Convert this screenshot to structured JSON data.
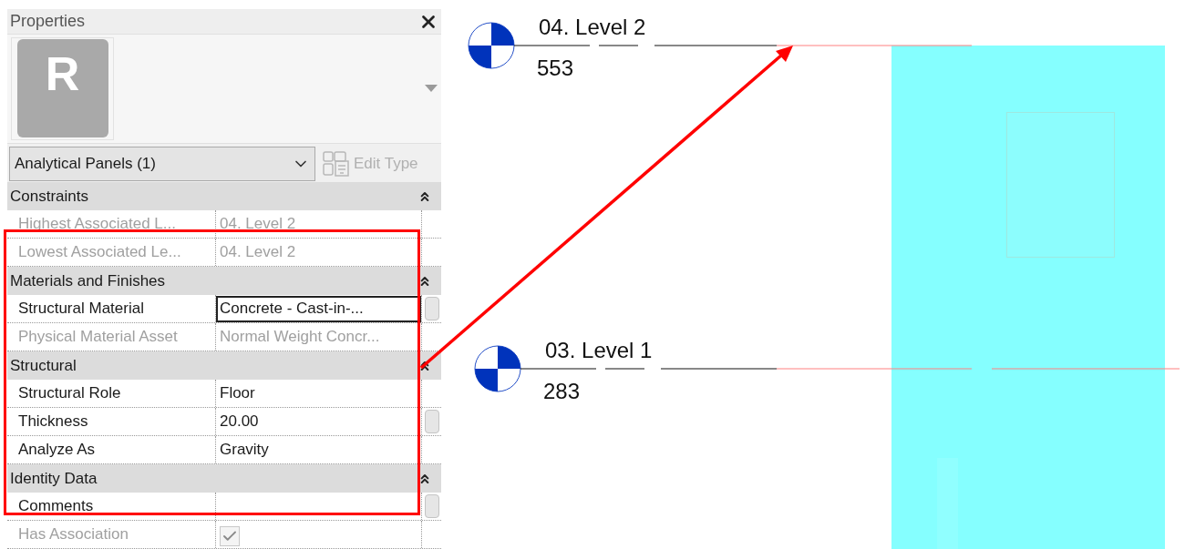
{
  "panel": {
    "title": "Properties",
    "logo_letter": "R",
    "type_selector": {
      "value": "Analytical Panels (1)"
    },
    "edit_type": {
      "label": "Edit Type",
      "disabled": true
    },
    "sections": [
      {
        "title": "Constraints",
        "rows": [
          {
            "kind": "text",
            "name": "Highest Associated L...",
            "value": "04. Level 2",
            "disabled": true,
            "editing": false,
            "has_button": false
          },
          {
            "kind": "text",
            "name": "Lowest Associated Le...",
            "value": "04. Level 2",
            "disabled": true,
            "editing": false,
            "has_button": false
          }
        ]
      },
      {
        "title": "Materials and Finishes",
        "rows": [
          {
            "kind": "text",
            "name": "Structural Material",
            "value": "Concrete - Cast-in-...",
            "disabled": false,
            "editing": true,
            "has_button": true
          },
          {
            "kind": "text",
            "name": "Physical Material Asset",
            "value": "Normal Weight Concr...",
            "disabled": true,
            "editing": false,
            "has_button": false
          }
        ]
      },
      {
        "title": "Structural",
        "rows": [
          {
            "kind": "text",
            "name": "Structural Role",
            "value": "Floor",
            "disabled": false,
            "editing": false,
            "has_button": false
          },
          {
            "kind": "text",
            "name": "Thickness",
            "value": "20.00",
            "disabled": false,
            "editing": false,
            "has_button": true
          },
          {
            "kind": "text",
            "name": "Analyze As",
            "value": "Gravity",
            "disabled": false,
            "editing": false,
            "has_button": false
          }
        ]
      },
      {
        "title": "Identity Data",
        "rows": [
          {
            "kind": "text",
            "name": "Comments",
            "disabled": false,
            "editing": false,
            "has_button": true
          },
          {
            "kind": "checkbox",
            "name": "Has Association",
            "checked": true,
            "disabled": true,
            "has_button": false
          }
        ]
      }
    ]
  },
  "levels": [
    {
      "name": "04. Level 2",
      "elevation": "553"
    },
    {
      "name": "03. Level 1",
      "elevation": "283"
    }
  ]
}
